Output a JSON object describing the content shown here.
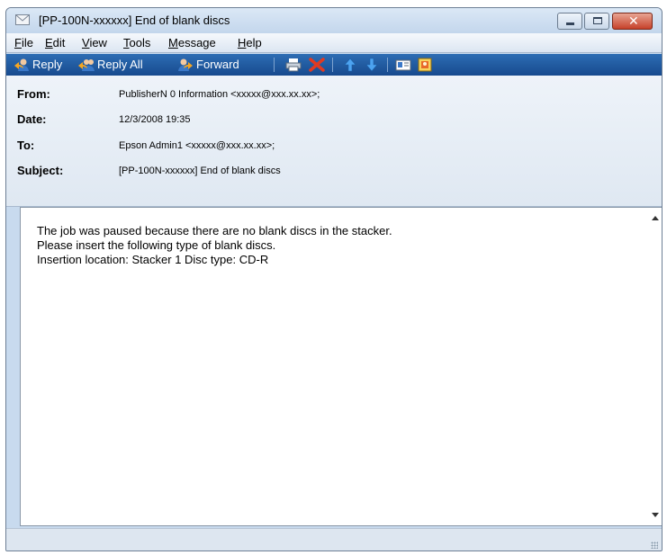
{
  "window": {
    "title": "[PP-100N-xxxxxx] End of blank discs"
  },
  "menu": [
    {
      "label": "File",
      "underline": "F",
      "rest": "ile"
    },
    {
      "label": "Edit",
      "underline": "E",
      "rest": "dit"
    },
    {
      "label": "View",
      "underline": "V",
      "rest": "iew"
    },
    {
      "label": "Tools",
      "underline": "T",
      "rest": "ools"
    },
    {
      "label": "Message",
      "underline": "M",
      "rest": "essage"
    },
    {
      "label": "Help",
      "underline": "H",
      "rest": "elp"
    }
  ],
  "toolbar": {
    "reply_label": "Reply",
    "reply_all_label": "Reply All",
    "forward_label": "Forward"
  },
  "header": {
    "from_label": "From:",
    "from_value": "PublisherN 0 Information <xxxxx@xxx.xx.xx>;",
    "date_label": "Date:",
    "date_value": "12/3/2008 19:35",
    "to_label": "To:",
    "to_value": "Epson Admin1 <xxxxx@xxx.xx.xx>;",
    "subject_label": "Subject:",
    "subject_value": "[PP-100N-xxxxxx] End of blank discs"
  },
  "message": {
    "line1": "The job was paused because there are no blank discs in the stacker.",
    "line2": "Please insert the following type of blank discs.",
    "line3": "Insertion location: Stacker 1 Disc type: CD-R"
  },
  "colors": {
    "toolbar_bg": "#1f5aa0",
    "close_button": "#c6412a"
  }
}
